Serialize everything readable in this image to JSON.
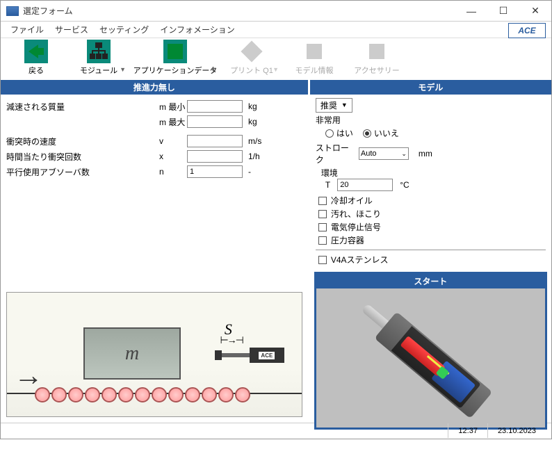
{
  "window": {
    "title": "選定フォーム"
  },
  "menubar": {
    "file": "ファイル",
    "service": "サービス",
    "settings": "セッティング",
    "info": "インフォメーション"
  },
  "logo": {
    "text": "ACE",
    "sub": ""
  },
  "toolbar": {
    "back": "戻る",
    "module": "モジュール",
    "appdata": "アプリケーションデータ",
    "print": "プリント Q1",
    "modelinfo": "モデル情報",
    "accessory": "アクセサリー"
  },
  "left": {
    "header": "推進力無し",
    "rows": {
      "mass": {
        "label": "減速される質量",
        "sym_min": "m 最小",
        "sym_max": "m 最大",
        "unit": "kg",
        "val_min": "",
        "val_max": ""
      },
      "velocity": {
        "label": "衝突時の速度",
        "sym": "v",
        "unit": "m/s",
        "val": ""
      },
      "cycles": {
        "label": "時間当たり衝突回数",
        "sym": "x",
        "unit": "1/h",
        "val": ""
      },
      "parallel": {
        "label": "平行使用アブソーバ数",
        "sym": "n",
        "unit": "-",
        "val": "1"
      }
    },
    "diagram": {
      "m": "m",
      "s": "S",
      "ace": "ACE"
    }
  },
  "right": {
    "header": "モデル",
    "recommend": "推奨",
    "emergency": {
      "label": "非常用",
      "yes": "はい",
      "no": "いいえ",
      "selected": "no"
    },
    "stroke": {
      "label": "ストローク",
      "value": "Auto",
      "unit": "mm"
    },
    "env": {
      "label": "環境",
      "t_sym": "T",
      "t_val": "20",
      "t_unit": "°C"
    },
    "checks": {
      "coolant": "冷却オイル",
      "dust": "汚れ、ほこり",
      "estop": "電気停止信号",
      "pressure": "圧力容器",
      "v4a": "V4Aステンレス"
    },
    "start": "スタート"
  },
  "status": {
    "time": "12:37",
    "date": "23.10.2023"
  }
}
